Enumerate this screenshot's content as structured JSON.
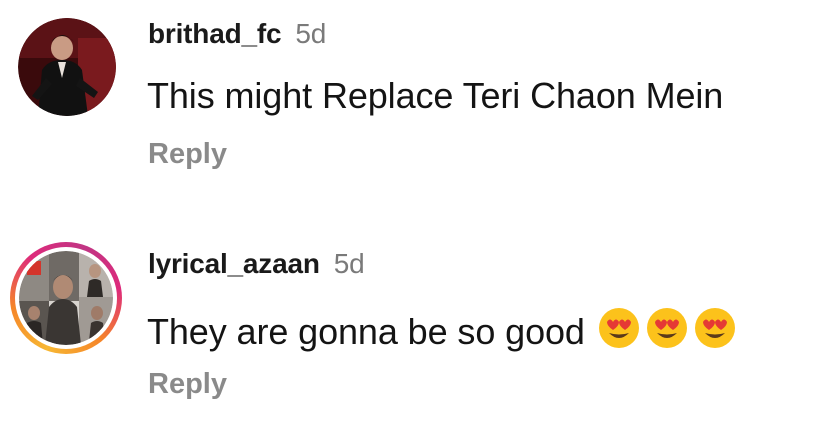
{
  "comments": [
    {
      "username": "brithad_fc",
      "time": "5d",
      "text": "This might Replace Teri Chaon Mein",
      "reply_label": "Reply",
      "has_story_ring": false
    },
    {
      "username": "lyrical_azaan",
      "time": "5d",
      "text": "They are gonna be so good",
      "emojis": [
        "heart-eyes-emoji",
        "heart-eyes-emoji",
        "heart-eyes-emoji"
      ],
      "reply_label": "Reply",
      "has_story_ring": true
    }
  ],
  "colors": {
    "username": "#1a1a1a",
    "time": "#7a7a7a",
    "reply": "#8a8a8a",
    "story_ring": [
      "#f7b733",
      "#f58529",
      "#dd2a7b",
      "#c13584"
    ]
  }
}
